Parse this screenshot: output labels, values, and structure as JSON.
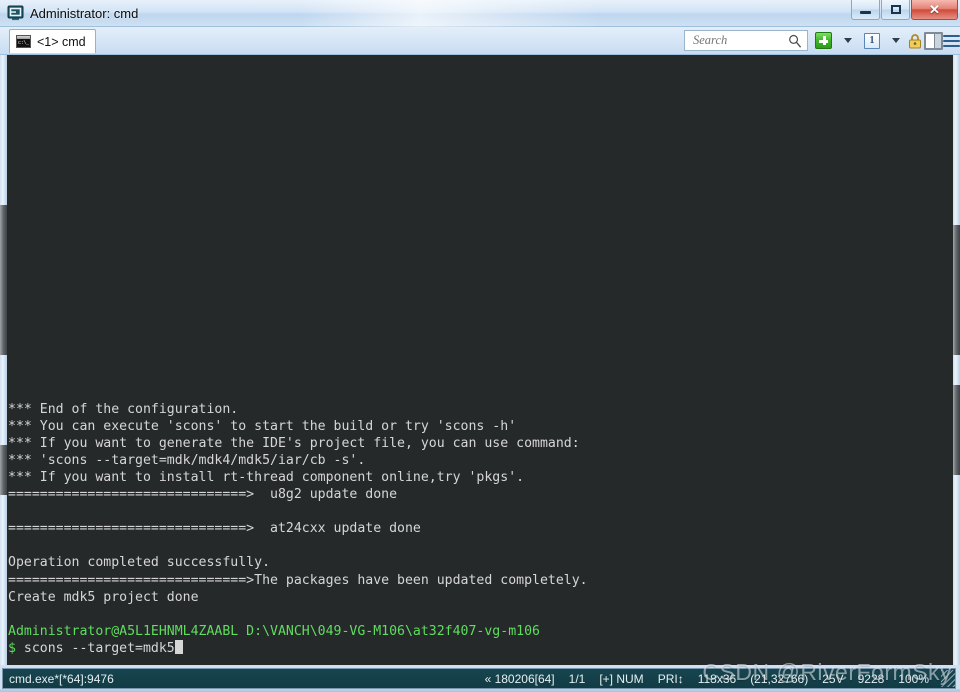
{
  "window": {
    "title": "Administrator: cmd",
    "app_icon": "console-icon",
    "controls": {
      "minimize_label": "Minimize",
      "maximize_label": "Restore",
      "close_label": "Close"
    }
  },
  "toolbar": {
    "tab": {
      "label": "<1> cmd",
      "icon": "cmd-console-icon"
    },
    "search": {
      "placeholder": "Search",
      "value": "",
      "icon": "search-icon"
    },
    "buttons": [
      {
        "name": "new-tab-button",
        "icon": "green-plus-icon"
      },
      {
        "name": "new-tab-dropdown",
        "icon": "chevron-down-icon"
      },
      {
        "name": "window-index-button",
        "icon": "number-one-icon",
        "label": "1"
      },
      {
        "name": "window-index-dropdown",
        "icon": "chevron-down-icon"
      },
      {
        "name": "lock-button",
        "icon": "padlock-icon"
      },
      {
        "name": "split-panel-button",
        "icon": "split-panel-icon"
      },
      {
        "name": "menu-button",
        "icon": "hamburger-menu-icon"
      }
    ]
  },
  "terminal": {
    "background_color": "#26292a",
    "text_color": "#d6d6d6",
    "prompt_color": "#5fdd5f",
    "lines": [
      {
        "text": "*** End of the configuration.",
        "color": "normal"
      },
      {
        "text": "*** You can execute 'scons' to start the build or try 'scons -h'",
        "color": "normal"
      },
      {
        "text": "*** If you want to generate the IDE's project file, you can use command:",
        "color": "normal"
      },
      {
        "text": "*** 'scons --target=mdk/mdk4/mdk5/iar/cb -s'.",
        "color": "normal"
      },
      {
        "text": "*** If you want to install rt-thread component online,try 'pkgs'.",
        "color": "normal"
      },
      {
        "text": "==============================>  u8g2 update done",
        "color": "normal"
      },
      {
        "text": "",
        "color": "normal"
      },
      {
        "text": "==============================>  at24cxx update done",
        "color": "normal"
      },
      {
        "text": "",
        "color": "normal"
      },
      {
        "text": "Operation completed successfully.",
        "color": "normal"
      },
      {
        "text": "==============================>The packages have been updated completely.",
        "color": "normal"
      },
      {
        "text": "Create mdk5 project done",
        "color": "normal"
      },
      {
        "text": "",
        "color": "normal"
      },
      {
        "text": "Administrator@A5L1EHNML4ZAABL D:\\VANCH\\049-VG-M106\\at32f407-vg-m106",
        "color": "green"
      }
    ],
    "prompt": {
      "sign": "$",
      "command": " scons --target=mdk5",
      "cursor": true
    }
  },
  "statusbar": {
    "process": "cmd.exe*[*64]:9476",
    "items": [
      "« 180206[64]",
      "1/1",
      "[+] NUM",
      "PRI↕",
      "118x36",
      "(21,32766)",
      "25V",
      "9228",
      "100%"
    ]
  },
  "watermark": {
    "text": "CSDN @RiverFormSky"
  }
}
